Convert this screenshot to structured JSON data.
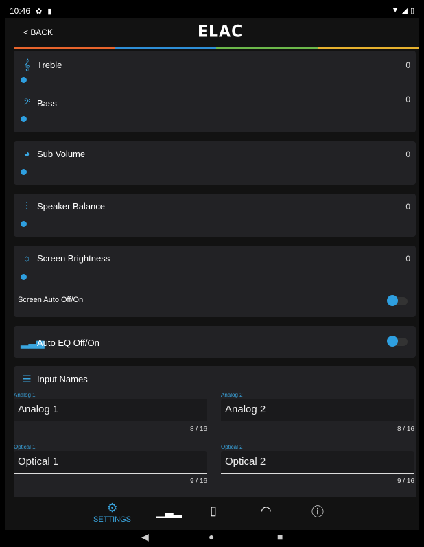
{
  "status": {
    "time": "10:46",
    "icons": [
      "settings-gear",
      "sd-card"
    ],
    "right_icons": [
      "wifi",
      "signal",
      "battery"
    ]
  },
  "header": {
    "back_label": "< BACK",
    "logo": "ELAC"
  },
  "stripe_colors": [
    "#e8642c",
    "#2e8ed6",
    "#6cb84a",
    "#e6b12e"
  ],
  "sections": {
    "treble": {
      "label": "Treble",
      "value": "0",
      "level": 0
    },
    "bass": {
      "label": "Bass",
      "value": "0",
      "level": 0
    },
    "sub_volume": {
      "label": "Sub Volume",
      "value": "0",
      "level": 0
    },
    "speaker_balance": {
      "label": "Speaker Balance",
      "value": "0",
      "level": 0
    },
    "screen_brightness": {
      "label": "Screen Brightness",
      "value": "0",
      "level": 0
    },
    "screen_auto": {
      "label": "Screen Auto Off/On",
      "on": true
    },
    "auto_eq": {
      "label": "Auto EQ Off/On",
      "on": true
    }
  },
  "input_names": {
    "title": "Input Names",
    "fields": [
      {
        "label": "Analog 1",
        "value": "Analog 1",
        "count": "8 / 16"
      },
      {
        "label": "Analog 2",
        "value": "Analog 2",
        "count": "8 / 16"
      },
      {
        "label": "Optical 1",
        "value": "Optical 1",
        "count": "9 / 16"
      },
      {
        "label": "Optical 2",
        "value": "Optical 2",
        "count": "9 / 16"
      }
    ]
  },
  "bottom_nav": {
    "settings_label": "SETTINGS"
  },
  "accent_color": "#2e9fe0"
}
